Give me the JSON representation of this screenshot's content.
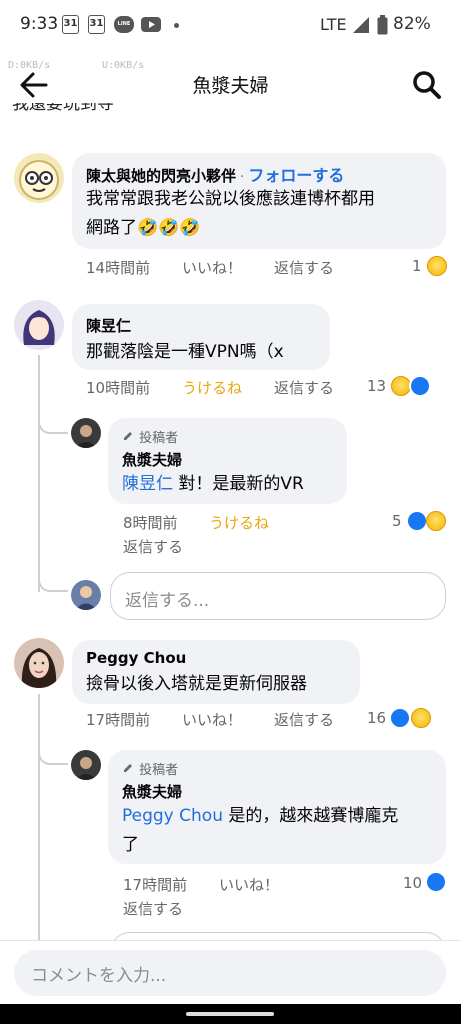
{
  "status_bar": {
    "time": "9:33",
    "cal1": "31",
    "cal2": "31",
    "line_icon_text": "LINE",
    "network": "LTE",
    "battery": "82%"
  },
  "nav": {
    "net_down": "D:0KB/s",
    "net_up": "U:0KB/s",
    "title": "魚漿夫婦"
  },
  "top_clip_text": "我還要玩到寺",
  "comments": [
    {
      "author": "陳太與她的閃亮小夥伴",
      "follow": "フォローする",
      "text_line1": "我常常跟我老公說以後應該連博杯都用",
      "text_line2": "網路了🤣🤣🤣",
      "time": "14時間前",
      "reaction": "いいね！",
      "reply": "返信する",
      "count": "1"
    },
    {
      "author": "陳昱仁",
      "text": "那觀落陰是一種VPN嗎（x",
      "time": "10時間前",
      "reaction": "うけるね",
      "reply": "返信する",
      "count": "13"
    },
    {
      "badge": "投稿者",
      "author": "魚漿夫婦",
      "mention": "陳昱仁",
      "text": " 對！是最新的VR",
      "time": "8時間前",
      "reaction": "うけるね",
      "reply": "返信する",
      "count": "5"
    },
    {
      "author": "Peggy Chou",
      "text": "撿骨以後入塔就是更新伺服器",
      "time": "17時間前",
      "reaction": "いいね！",
      "reply": "返信する",
      "count": "16"
    },
    {
      "badge": "投稿者",
      "author": "魚漿夫婦",
      "mention": "Peggy Chou",
      "text_line1": " 是的，越來越賽博龐克",
      "text_line2": "了",
      "time": "17時間前",
      "reaction": "いいね！",
      "reply": "返信する",
      "count": "10"
    }
  ],
  "reply_placeholder": "返信する...",
  "comment_placeholder": "コメントを入力...",
  "colors": {
    "link": "#216fdb",
    "haha": "#e8a80c",
    "bubble": "#f0f2f5",
    "like": "#1877f2"
  }
}
